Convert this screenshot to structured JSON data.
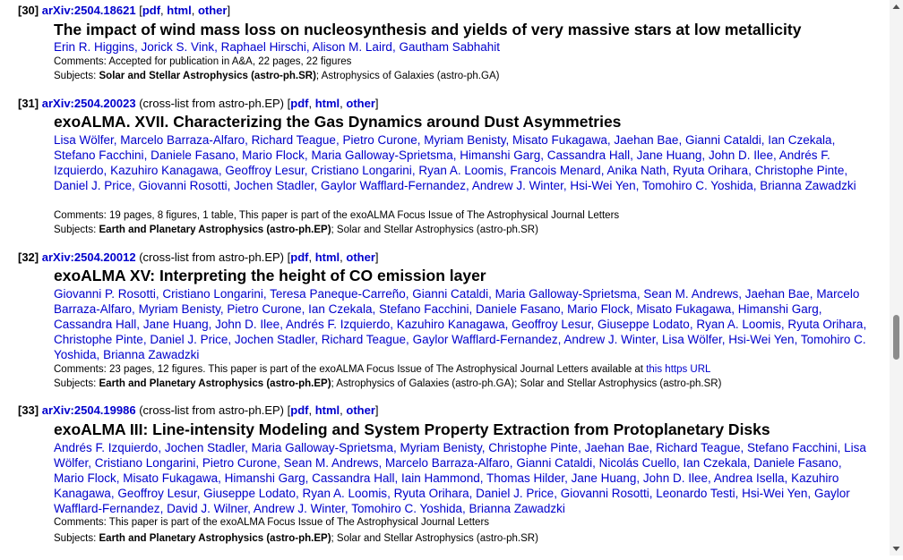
{
  "entries": [
    {
      "number": "[30]",
      "arxiv_id": "arXiv:2504.18621",
      "cross_list": "",
      "pdf": "pdf",
      "html": "html",
      "other": "other",
      "title": "The impact of wind mass loss on nucleosynthesis and yields of very massive stars at low metallicity",
      "authors": [
        "Erin R. Higgins",
        "Jorick S. Vink",
        "Raphael Hirschi",
        "Alison M. Laird",
        "Gautham Sabhahit"
      ],
      "comments_label": "Comments:",
      "comments": "Accepted for publication in A&A, 22 pages, 22 figures",
      "comments_link": "",
      "subjects_label": "Subjects:",
      "subjects_primary": "Solar and Stellar Astrophysics (astro-ph.SR)",
      "subjects_rest": "; Astrophysics of Galaxies (astro-ph.GA)"
    },
    {
      "number": "[31]",
      "arxiv_id": "arXiv:2504.20023",
      "cross_list": "(cross-list from astro-ph.EP)",
      "pdf": "pdf",
      "html": "html",
      "other": "other",
      "title": "exoALMA. XVII. Characterizing the Gas Dynamics around Dust Asymmetries",
      "authors": [
        "Lisa Wölfer",
        "Marcelo Barraza-Alfaro",
        "Richard Teague",
        "Pietro Curone",
        "Myriam Benisty",
        "Misato Fukagawa",
        "Jaehan Bae",
        "Gianni Cataldi",
        "Ian Czekala",
        "Stefano Facchini",
        "Daniele Fasano",
        "Mario Flock",
        "Maria Galloway-Sprietsma",
        "Himanshi Garg",
        "Cassandra Hall",
        "Jane Huang",
        "John D. Ilee",
        "Andrés F. Izquierdo",
        "Kazuhiro Kanagawa",
        "Geoffroy Lesur",
        "Cristiano Longarini",
        "Ryan A. Loomis",
        "Francois Menard",
        "Anika Nath",
        "Ryuta Orihara",
        "Christophe Pinte",
        "Daniel J. Price",
        "Giovanni Rosotti",
        "Jochen Stadler",
        "Gaylor Wafflard-Fernandez",
        "Andrew J. Winter",
        "Hsi-Wei Yen",
        "Tomohiro C. Yoshida",
        "Brianna Zawadzki"
      ],
      "comments_label": "Comments:",
      "comments": "19 pages, 8 figures, 1 table, This paper is part of the exoALMA Focus Issue of The Astrophysical Journal Letters",
      "comments_link": "",
      "subjects_label": "Subjects:",
      "subjects_primary": "Earth and Planetary Astrophysics (astro-ph.EP)",
      "subjects_rest": "; Solar and Stellar Astrophysics (astro-ph.SR)"
    },
    {
      "number": "[32]",
      "arxiv_id": "arXiv:2504.20012",
      "cross_list": "(cross-list from astro-ph.EP)",
      "pdf": "pdf",
      "html": "html",
      "other": "other",
      "title": "exoALMA XV: Interpreting the height of CO emission layer",
      "authors": [
        "Giovanni P. Rosotti",
        "Cristiano Longarini",
        "Teresa Paneque-Carreño",
        "Gianni Cataldi",
        "Maria Galloway-Sprietsma",
        "Sean M. Andrews",
        "Jaehan Bae",
        "Marcelo Barraza-Alfaro",
        "Myriam Benisty",
        "Pietro Curone",
        "Ian Czekala",
        "Stefano Facchini",
        "Daniele Fasano",
        "Mario Flock",
        "Misato Fukagawa",
        "Himanshi Garg",
        "Cassandra Hall",
        "Jane Huang",
        "John D. Ilee",
        "Andrés F. Izquierdo",
        "Kazuhiro Kanagawa",
        "Geoffroy Lesur",
        "Giuseppe Lodato",
        "Ryan A. Loomis",
        "Ryuta Orihara",
        "Christophe Pinte",
        "Daniel J. Price",
        "Jochen Stadler",
        "Richard Teague",
        "Gaylor Wafflard-Fernandez",
        "Andrew J. Winter",
        "Lisa Wölfer",
        "Hsi-Wei Yen",
        "Tomohiro C. Yoshida",
        "Brianna Zawadzki"
      ],
      "comments_label": "Comments:",
      "comments": "23 pages, 12 figures. This paper is part of the exoALMA Focus Issue of The Astrophysical Journal Letters available at ",
      "comments_link": "this https URL",
      "subjects_label": "Subjects:",
      "subjects_primary": "Earth and Planetary Astrophysics (astro-ph.EP)",
      "subjects_rest": "; Astrophysics of Galaxies (astro-ph.GA); Solar and Stellar Astrophysics (astro-ph.SR)"
    },
    {
      "number": "[33]",
      "arxiv_id": "arXiv:2504.19986",
      "cross_list": "(cross-list from astro-ph.EP)",
      "pdf": "pdf",
      "html": "html",
      "other": "other",
      "title": "exoALMA III: Line-intensity Modeling and System Property Extraction from Protoplanetary Disks",
      "authors": [
        "Andrés F. Izquierdo",
        "Jochen Stadler",
        "Maria Galloway-Sprietsma",
        "Myriam Benisty",
        "Christophe Pinte",
        "Jaehan Bae",
        "Richard Teague",
        "Stefano Facchini",
        "Lisa Wölfer",
        "Cristiano Longarini",
        "Pietro Curone",
        "Sean M. Andrews",
        "Marcelo Barraza-Alfaro",
        "Gianni Cataldi",
        "Nicolás Cuello",
        "Ian Czekala",
        "Daniele Fasano",
        "Mario Flock",
        "Misato Fukagawa",
        "Himanshi Garg",
        "Cassandra Hall",
        "Iain Hammond",
        "Thomas Hilder",
        "Jane Huang",
        "John D. Ilee",
        "Andrea Isella",
        "Kazuhiro Kanagawa",
        "Geoffroy Lesur",
        "Giuseppe Lodato",
        "Ryan A. Loomis",
        "Ryuta Orihara",
        "Daniel J. Price",
        "Giovanni Rosotti",
        "Leonardo Testi",
        "Hsi-Wei Yen",
        "Gaylor Wafflard-Fernandez",
        "David J. Wilner",
        "Andrew J. Winter",
        "Tomohiro C. Yoshida",
        "Brianna Zawadzki"
      ],
      "comments_label": "Comments:",
      "comments": "This paper is part of the exoALMA Focus Issue of The Astrophysical Journal Letters",
      "comments_link": "",
      "subjects_label": "Subjects:",
      "subjects_primary": "Earth and Planetary Astrophysics (astro-ph.EP)",
      "subjects_rest": "; Solar and Stellar Astrophysics (astro-ph.SR)"
    }
  ],
  "scrollbar": {
    "up_icon": "triangle-up-icon",
    "down_icon": "triangle-down-icon"
  }
}
